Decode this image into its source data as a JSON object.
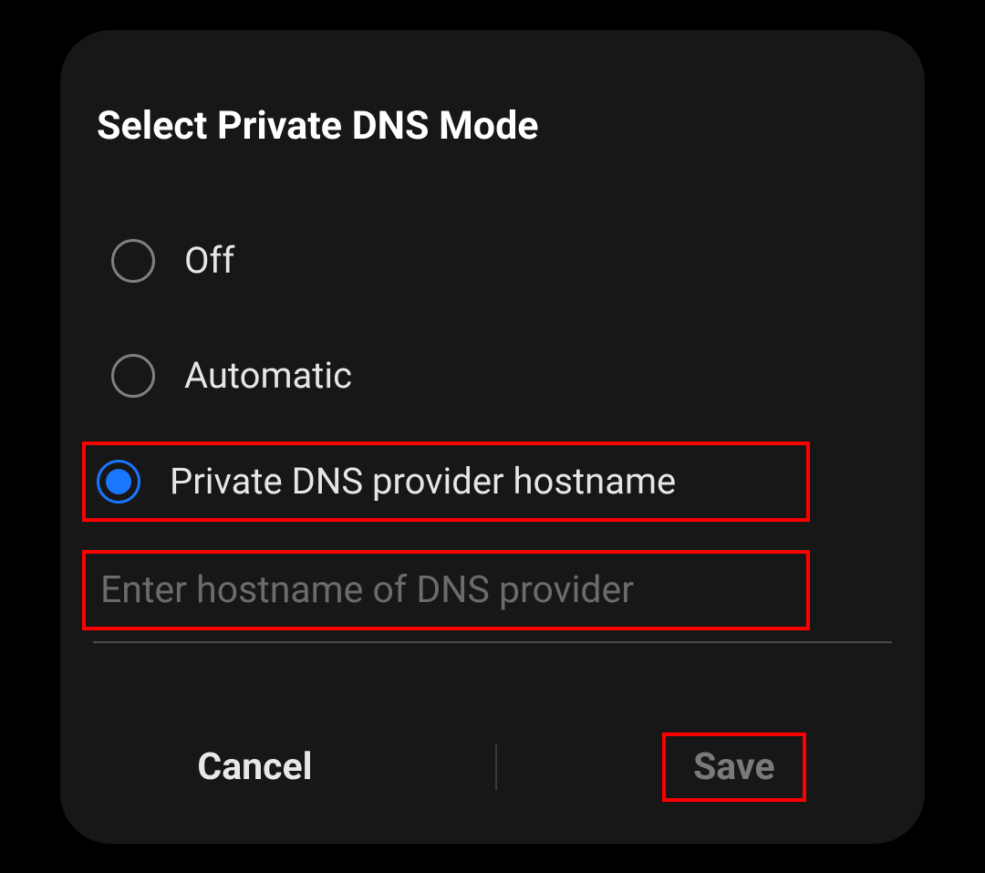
{
  "dialog": {
    "title": "Select Private DNS Mode",
    "options": [
      {
        "label": "Off",
        "selected": false
      },
      {
        "label": "Automatic",
        "selected": false
      },
      {
        "label": "Private DNS provider hostname",
        "selected": true
      }
    ],
    "input": {
      "placeholder": "Enter hostname of DNS provider",
      "value": ""
    },
    "buttons": {
      "cancel": "Cancel",
      "save": "Save"
    }
  }
}
